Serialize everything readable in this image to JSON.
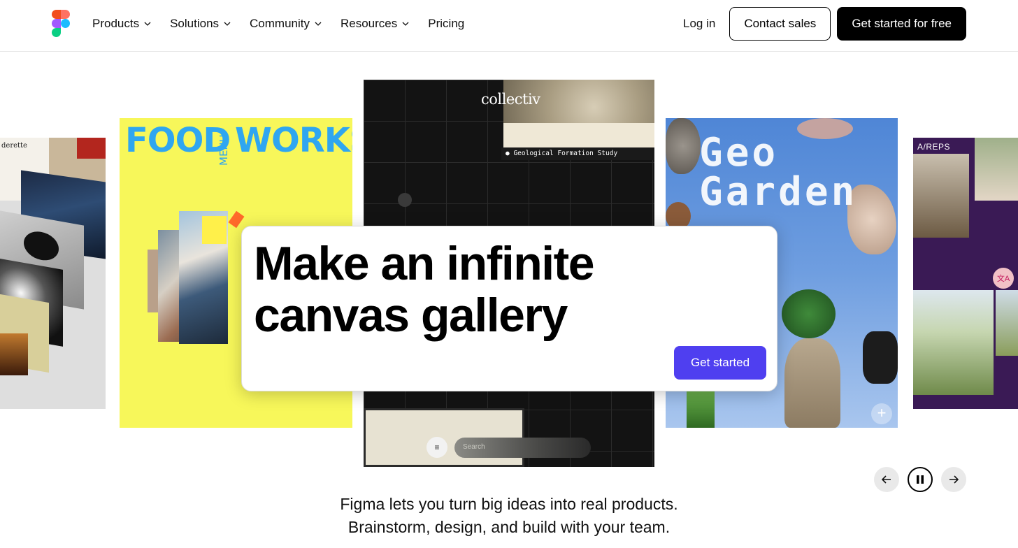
{
  "nav": {
    "logo_icon": "figma-logo-icon",
    "links": [
      {
        "label": "Products",
        "has_dropdown": true
      },
      {
        "label": "Solutions",
        "has_dropdown": true
      },
      {
        "label": "Community",
        "has_dropdown": true
      },
      {
        "label": "Resources",
        "has_dropdown": true
      },
      {
        "label": "Pricing",
        "has_dropdown": false
      }
    ],
    "login_label": "Log in",
    "contact_label": "Contact sales",
    "cta_label": "Get started for free"
  },
  "gallery": {
    "left_card_text": "derette",
    "food_card": {
      "title_left": "FOOD",
      "menu": "MENU",
      "title_right": "WORKS"
    },
    "collectiv_card": {
      "brand": "collectiv",
      "caption": "Geological Formation Study",
      "search_placeholder": "Search"
    },
    "geo_card": {
      "title_line1": "Geo",
      "title_line2": "Garden"
    },
    "reps_card": {
      "label": "A/REPS"
    }
  },
  "hero": {
    "title": "Make an infinite canvas gallery",
    "button_label": "Get started",
    "accent_color": "#4f3ff0"
  },
  "controls": {
    "prev_icon": "arrow-left-icon",
    "pause_icon": "pause-icon",
    "next_icon": "arrow-right-icon"
  },
  "tagline": {
    "line1": "Figma lets you turn big ideas into real products.",
    "line2": "Brainstorm, design, and build with your team."
  }
}
